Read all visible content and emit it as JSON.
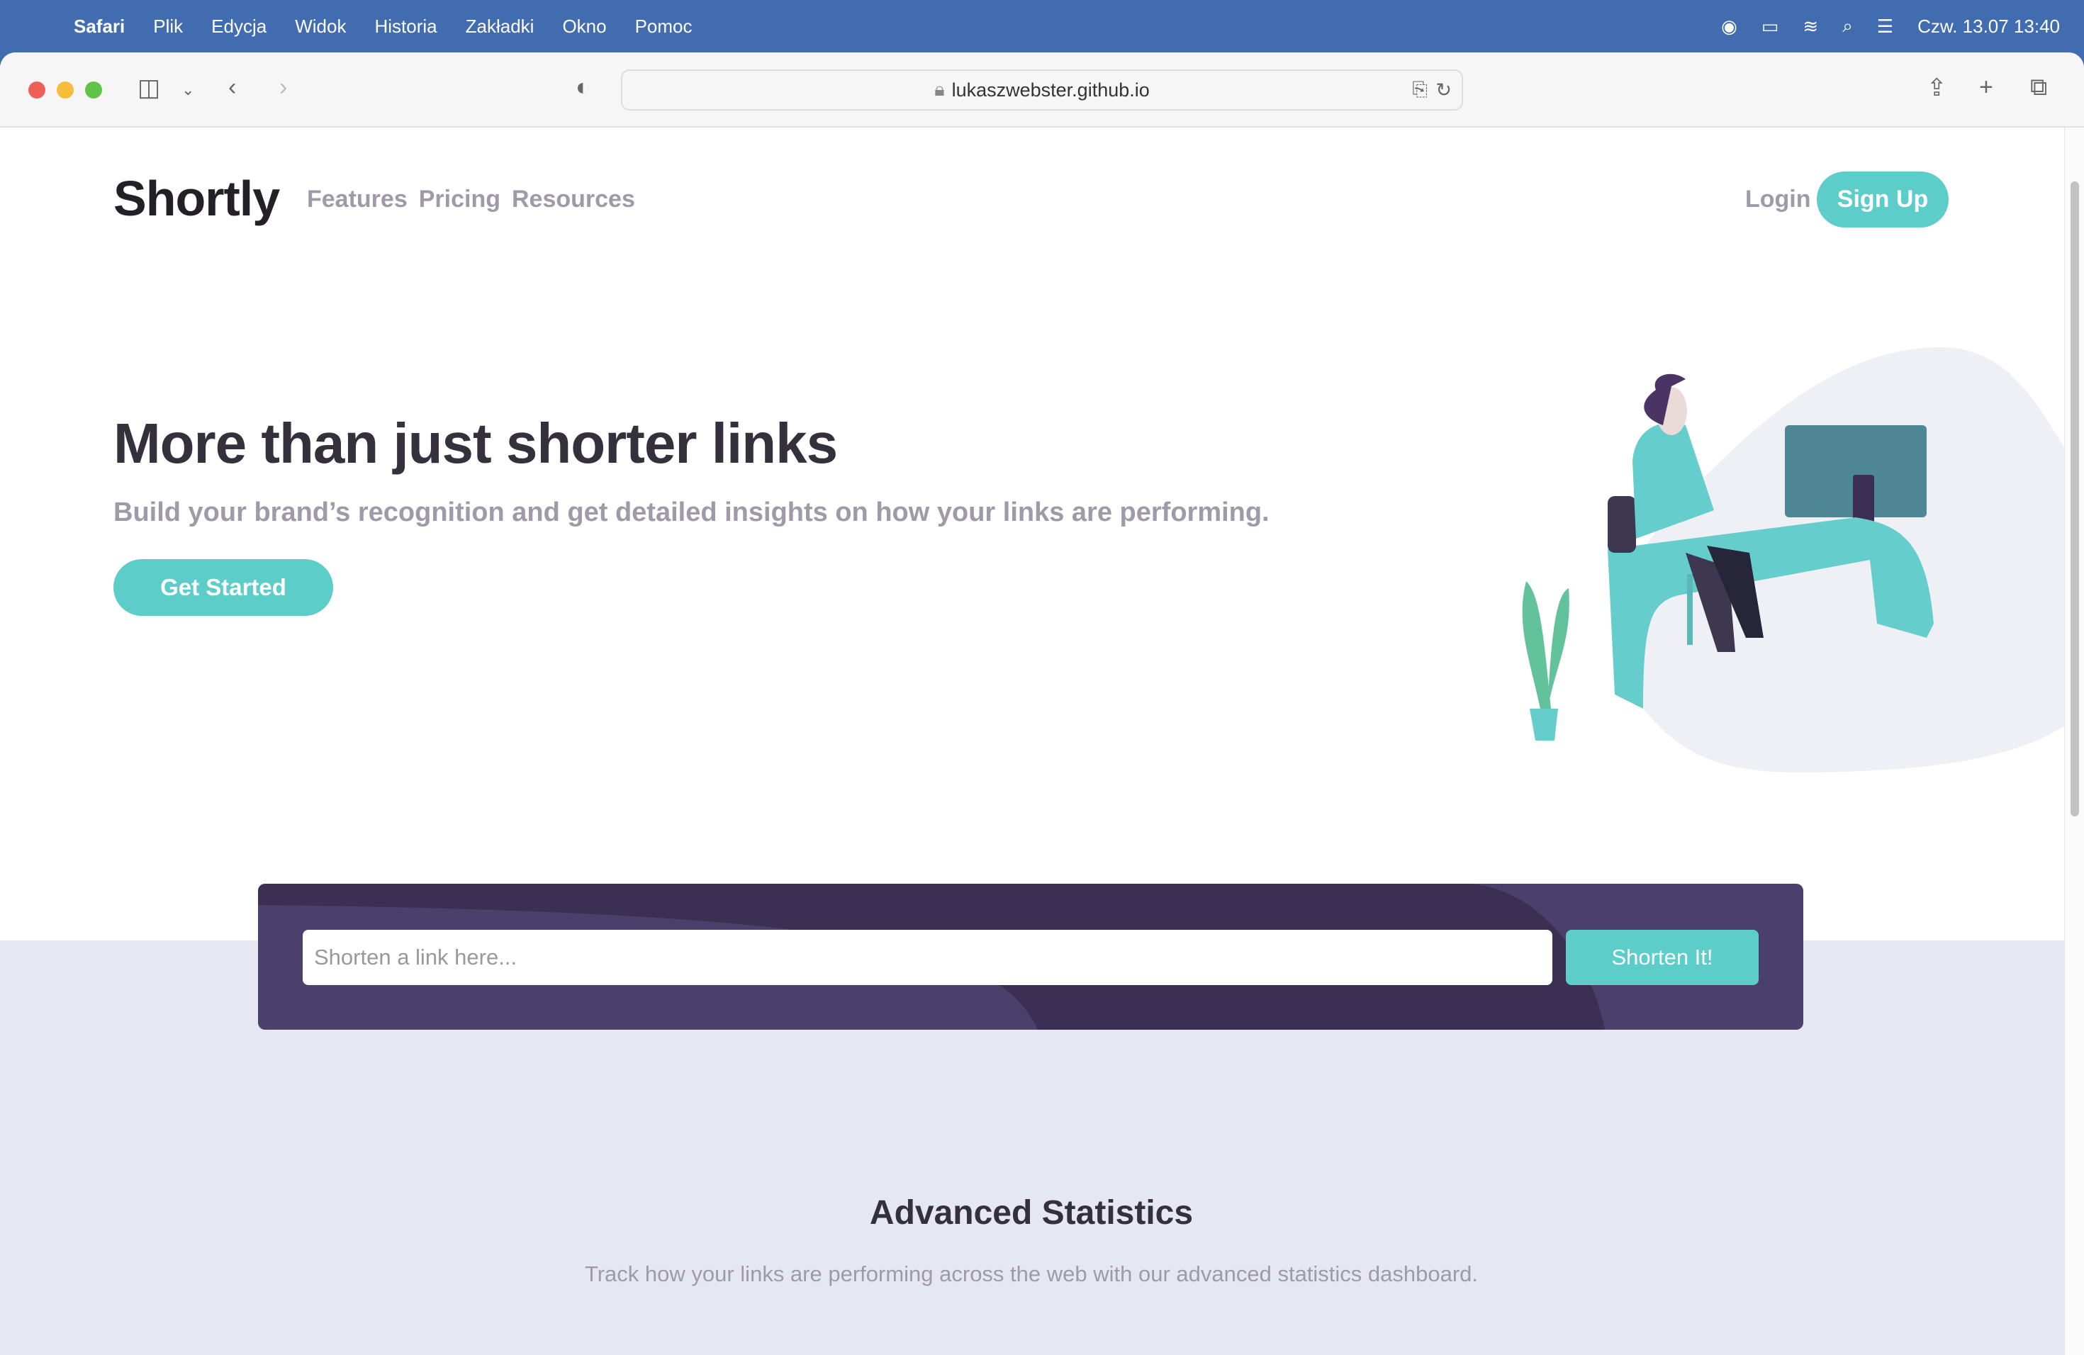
{
  "menubar": {
    "app": "Safari",
    "items": [
      "Plik",
      "Edycja",
      "Widok",
      "Historia",
      "Zakładki",
      "Okno",
      "Pomoc"
    ],
    "clock": "Czw. 13.07  13:40"
  },
  "browser": {
    "url": "lukaszwebster.github.io"
  },
  "site": {
    "logo": "Shortly",
    "nav": [
      "Features",
      "Pricing",
      "Resources"
    ],
    "login": "Login",
    "signup": "Sign Up",
    "hero_title": "More than just shorter links",
    "hero_sub": "Build your brand’s recognition and get detailed insights on how your links are performing.",
    "cta": "Get Started",
    "shorten_placeholder": "Shorten a link here...",
    "shorten_button": "Shorten It!",
    "stats_title": "Advanced Statistics",
    "stats_sub": "Track how your links are performing across the web with our advanced statistics dashboard."
  },
  "colors": {
    "accent": "#5dcdc9",
    "dark_violet": "#4b3f6b",
    "menubar": "#416db0"
  }
}
